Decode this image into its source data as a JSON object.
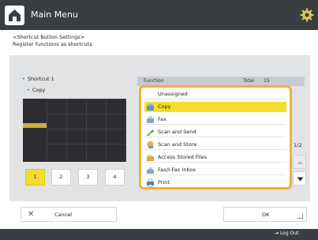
{
  "header": {
    "title": "Main Menu",
    "home_icon": "home-icon",
    "settings_icon": "gear-icon"
  },
  "instructions": {
    "line1": "<Shortcut Button Settings>",
    "line2": "Register functions as shortcuts."
  },
  "shortcut": {
    "title": "Shortcut 1",
    "subtitle": "Copy",
    "pages": [
      "1",
      "2",
      "3",
      "4"
    ],
    "selected_page": "1"
  },
  "function_list": {
    "header": {
      "function": "Function",
      "total": "Total",
      "count": "15"
    },
    "items": [
      {
        "label": "Unassigned",
        "icon": "",
        "selected": false
      },
      {
        "label": "Copy",
        "icon": "copy-icon",
        "selected": true
      },
      {
        "label": "Fax",
        "icon": "fax-icon",
        "selected": false
      },
      {
        "label": "Scan and Send",
        "icon": "scan-send-icon",
        "selected": false
      },
      {
        "label": "Scan and Store",
        "icon": "scan-store-icon",
        "selected": false
      },
      {
        "label": "Access Stored Files",
        "icon": "stored-files-icon",
        "selected": false
      },
      {
        "label": "Fax/I-Fax Inbox",
        "icon": "fax-inbox-icon",
        "selected": false
      },
      {
        "label": "Print",
        "icon": "print-icon",
        "selected": false
      }
    ],
    "page_indicator": "1/2"
  },
  "buttons": {
    "cancel": "Cancel",
    "ok": "OK"
  },
  "footer": {
    "logout": "Log Out"
  },
  "colors": {
    "header_bg": "#3a3d41",
    "accent_yellow": "#f6dd2c",
    "list_border": "#f2b231",
    "panel_bg": "#e2e3e5"
  }
}
